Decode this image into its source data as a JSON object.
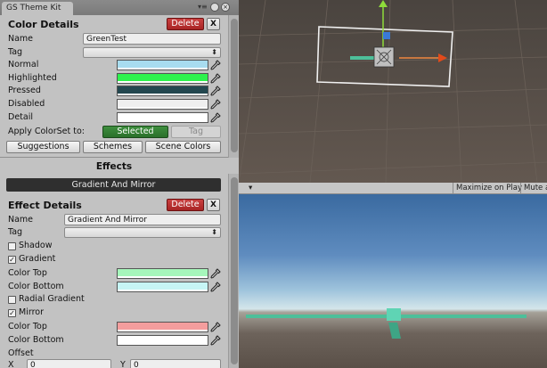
{
  "window": {
    "tab_title": "GS Theme Kit",
    "menu_glyph": "▾≡",
    "close_glyph": "×"
  },
  "color_details": {
    "title": "Color Details",
    "delete_label": "Delete",
    "close_label": "X",
    "name_label": "Name",
    "name_value": "GreenTest",
    "tag_label": "Tag",
    "tag_value": "",
    "swatches": [
      {
        "label": "Normal",
        "color": "#a8dcef"
      },
      {
        "label": "Highlighted",
        "color": "#2ef24d"
      },
      {
        "label": "Pressed",
        "color": "#23474f"
      },
      {
        "label": "Disabled",
        "color": "#efefef"
      },
      {
        "label": "Detail",
        "color": "#ffffff"
      }
    ],
    "apply_label": "Apply ColorSet to:",
    "selected_label": "Selected",
    "tag_button_label": "Tag",
    "buttons": [
      "Suggestions",
      "Schemes",
      "Scene Colors"
    ]
  },
  "effects": {
    "title": "Effects",
    "bar_label": "Gradient And Mirror"
  },
  "effect_details": {
    "title": "Effect Details",
    "delete_label": "Delete",
    "close_label": "X",
    "name_label": "Name",
    "name_value": "Gradient And Mirror",
    "tag_label": "Tag",
    "tag_value": "",
    "shadow_label": "Shadow",
    "shadow_checked": false,
    "gradient_label": "Gradient",
    "gradient_checked": true,
    "gradient_top_label": "Color Top",
    "gradient_top_color": "#a6f6bb",
    "gradient_bottom_label": "Color Bottom",
    "gradient_bottom_color": "#c6f5f5",
    "radial_label": "Radial Gradient",
    "radial_checked": false,
    "mirror_label": "Mirror",
    "mirror_checked": true,
    "mirror_top_label": "Color Top",
    "mirror_top_color": "#f49d9d",
    "mirror_bottom_label": "Color Bottom",
    "mirror_bottom_color": "#ffffff",
    "offset_label": "Offset",
    "offset_x_label": "X",
    "offset_x_value": "0",
    "offset_y_label": "Y",
    "offset_y_value": "0"
  },
  "game_toolbar": {
    "menu_glyph": "▾",
    "maximize_label": "Maximize on Play",
    "mute_label": "Mute a"
  },
  "colors": {
    "delete_red": "#b52f2f",
    "selected_green": "#357f35",
    "panel_bg": "#c2c2c2",
    "scene_bg": "#5a5048",
    "effect_bar": "#2f2f2f",
    "ground_bar": "#4dbf9a"
  }
}
